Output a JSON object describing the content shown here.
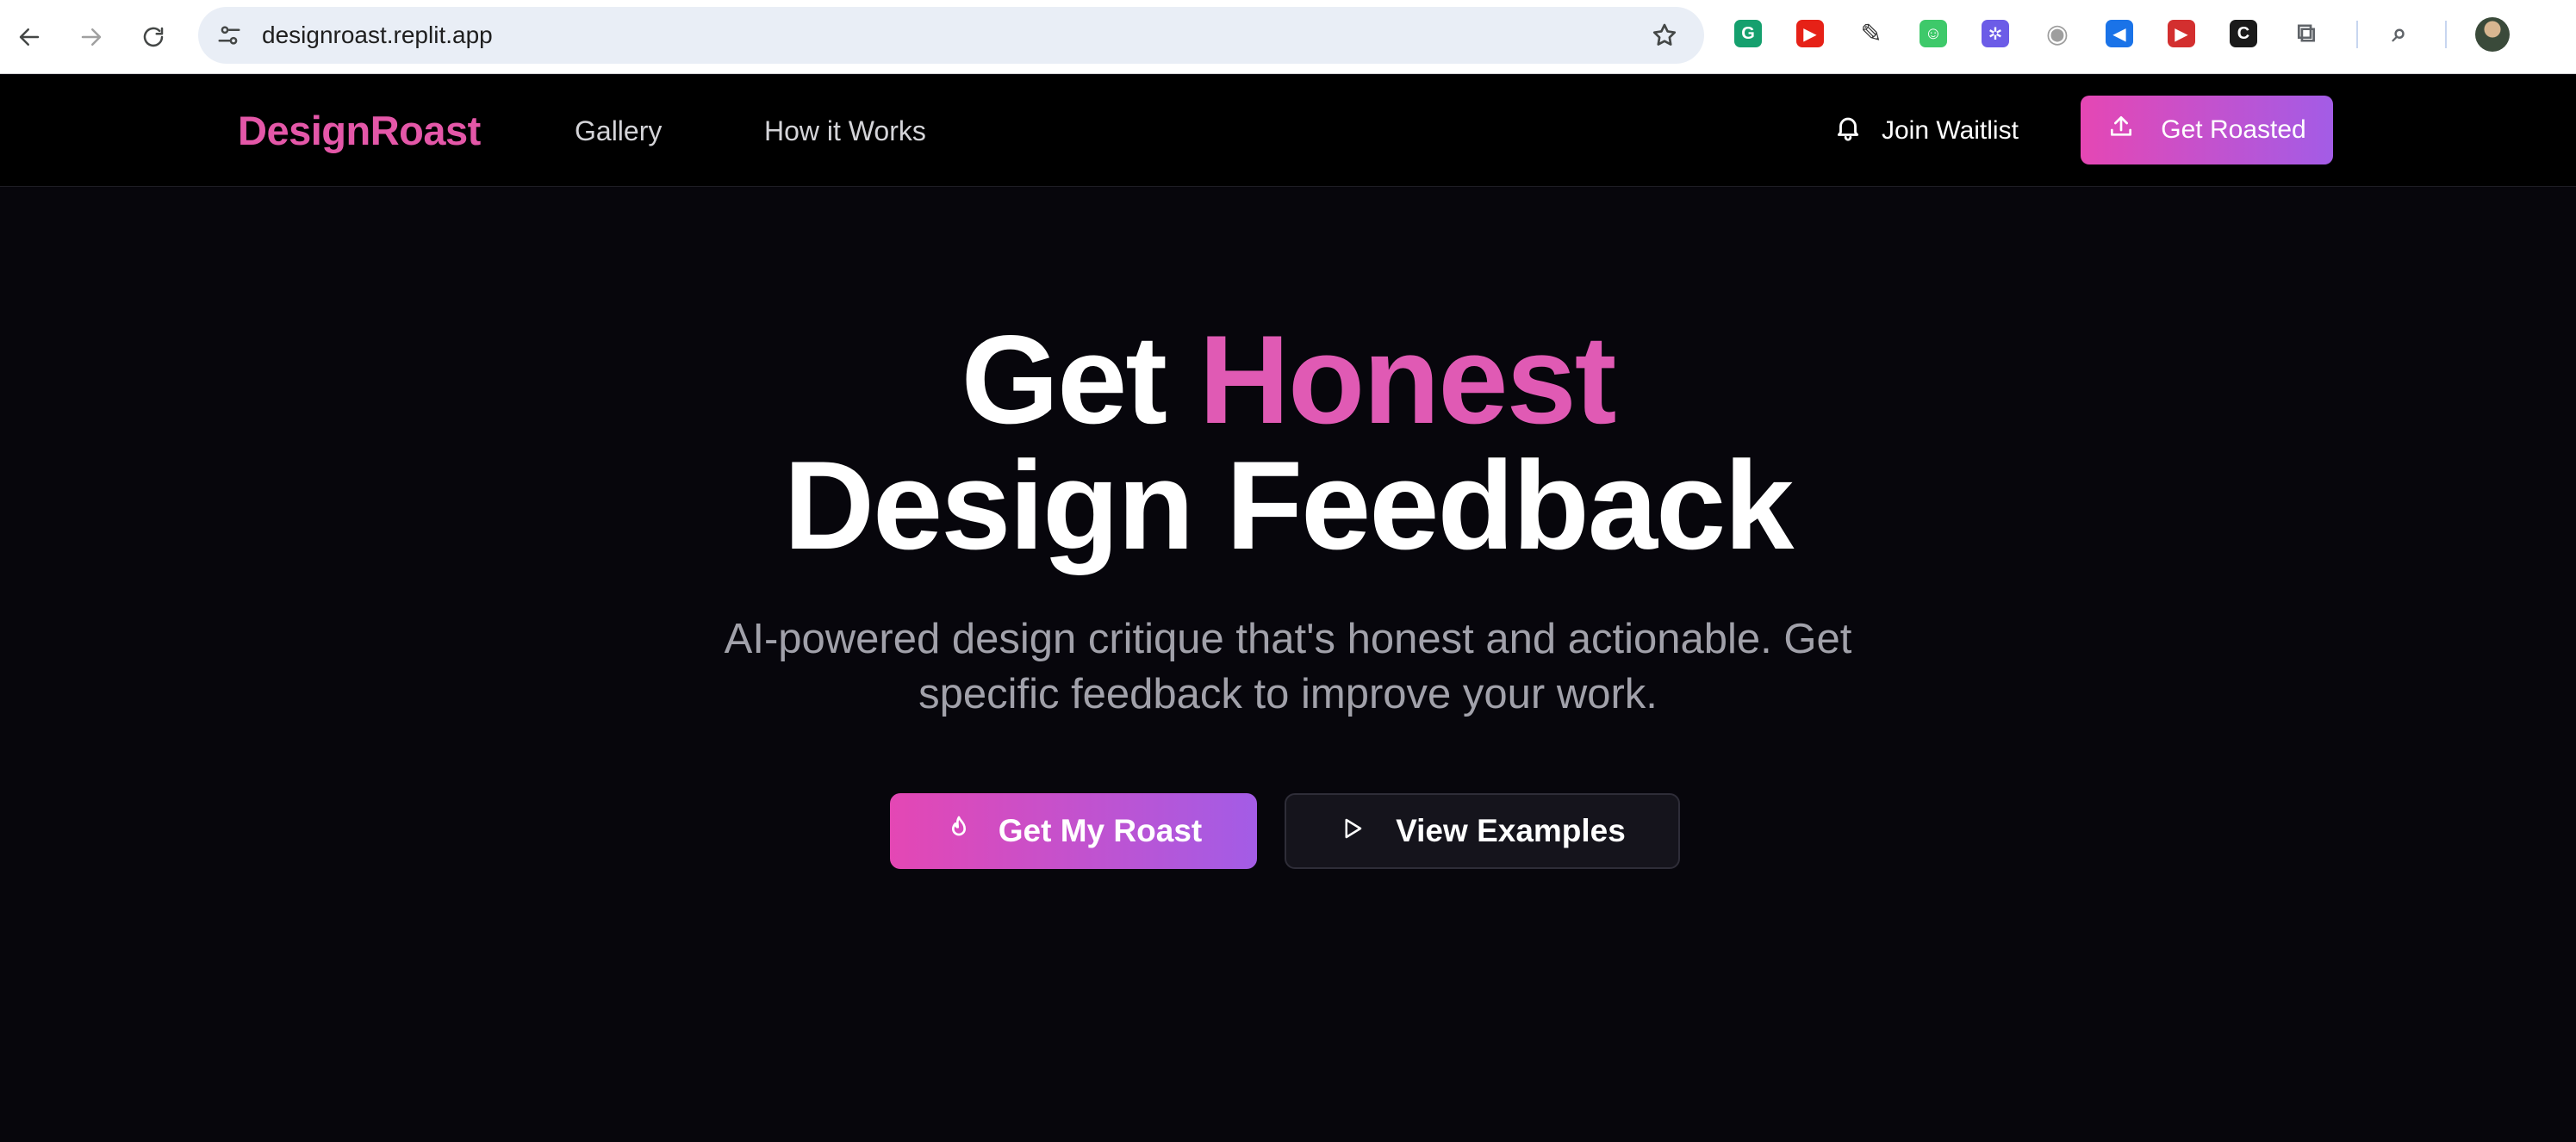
{
  "browser": {
    "url": "designroast.replit.app",
    "icons": {
      "back": "back-arrow-icon",
      "forward": "forward-arrow-icon",
      "reload": "reload-icon",
      "site_info": "tune-icon",
      "bookmark": "star-icon"
    },
    "extensions": [
      {
        "name": "grammarly-icon",
        "color": "#15a06e",
        "glyph": "G"
      },
      {
        "name": "youtube-icon",
        "color": "#e62117",
        "glyph": "▶"
      },
      {
        "name": "eyedropper-icon",
        "color": "#333333",
        "glyph": "✎"
      },
      {
        "name": "green-extension-icon",
        "color": "#3ec96a",
        "glyph": "☺"
      },
      {
        "name": "purple-extension-icon",
        "color": "#6c5ce7",
        "glyph": "✲"
      },
      {
        "name": "camera-icon",
        "color": "#9e9e9e",
        "glyph": "◉"
      },
      {
        "name": "blue-rewind-icon",
        "color": "#1a73e8",
        "glyph": "◀"
      },
      {
        "name": "red-forward-icon",
        "color": "#d32f2f",
        "glyph": "▶"
      },
      {
        "name": "black-c-icon",
        "color": "#1a1a1a",
        "glyph": "C"
      },
      {
        "name": "puzzle-extensions-icon",
        "color": "#5f6368",
        "glyph": "⧉"
      },
      {
        "name": "tab-search-icon",
        "color": "#5f6368",
        "glyph": "⌕"
      }
    ]
  },
  "header": {
    "logo": "DesignRoast",
    "nav": [
      {
        "label": "Gallery"
      },
      {
        "label": "How it Works"
      }
    ],
    "waitlist_label": "Join Waitlist",
    "cta_label": "Get Roasted"
  },
  "hero": {
    "title_prefix": "Get",
    "title_accent": "Honest",
    "title_line2": "Design Feedback",
    "subtitle_line1": "AI-powered design critique that's honest and actionable. Get",
    "subtitle_line2": "specific feedback to improve your work.",
    "primary_button": "Get My Roast",
    "secondary_button": "View Examples"
  },
  "colors": {
    "brand_pink": "#e457a8",
    "gradient_start": "#e547b4",
    "gradient_end": "#a35ce6",
    "background": "#07060c"
  }
}
